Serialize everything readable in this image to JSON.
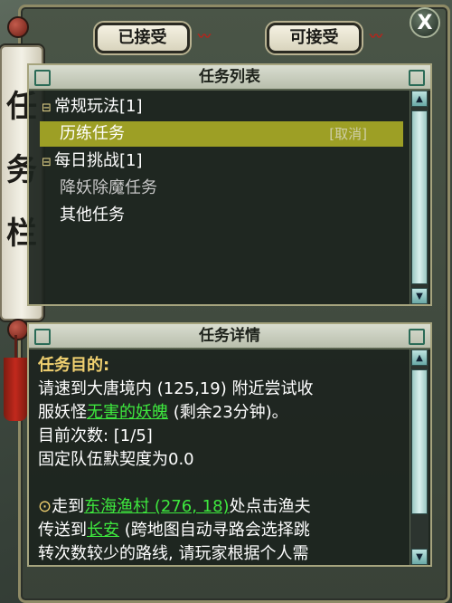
{
  "window": {
    "title_chars": [
      "任",
      "务",
      "栏"
    ],
    "close_label": "X"
  },
  "tabs": {
    "accepted": "已接受",
    "available": "可接受"
  },
  "task_list": {
    "header": "任务列表",
    "categories": [
      {
        "toggle": "⊟",
        "label": "常规玩法[1]",
        "tasks": [
          {
            "label": "历练任务",
            "selected": true,
            "action": "[取消]"
          }
        ]
      },
      {
        "toggle": "⊟",
        "label": "每日挑战[1]",
        "tasks": [
          {
            "label": "降妖除魔任务",
            "selected": false
          }
        ]
      }
    ],
    "other_tasks": "其他任务"
  },
  "details": {
    "header": "任务详情",
    "goal_title": "任务目的:",
    "line1": "请速到大唐境内 (125,19) 附近尝试收",
    "line2_prefix": "服妖怪",
    "line2_link": "无害的妖魄",
    "line2_suffix": " (剩余23分钟)。",
    "count_line": "目前次数: [1/5]",
    "tacit_line": "固定队伍默契度为0.0",
    "hint_icon": "⊙",
    "hint1_prefix": "走到",
    "hint1_link": "东海渔村 (276, 18)",
    "hint1_suffix": "处点击渔夫",
    "hint2_prefix": "传送到",
    "hint2_link": "长安",
    "hint2_suffix": " (跨地图自动寻路会选择跳",
    "hint3": "转次数较少的路线, 请玩家根据个人需"
  },
  "colors": {
    "selected_row": "#9d9f25",
    "link": "#3ee83e",
    "goal_title": "#f0d070"
  }
}
